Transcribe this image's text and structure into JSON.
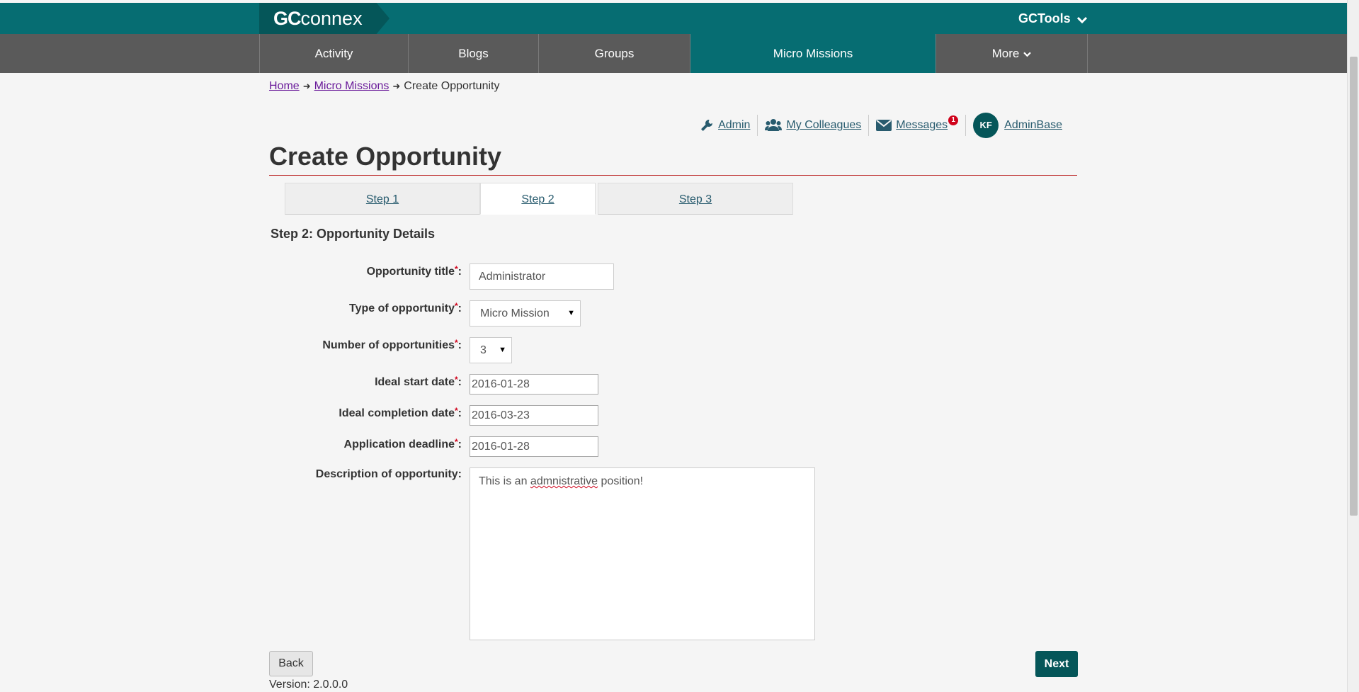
{
  "header": {
    "logo_bold": "GC",
    "logo_rest": "connex",
    "gctools_label": "GCTools"
  },
  "nav": {
    "items": [
      {
        "label": "Activity"
      },
      {
        "label": "Blogs"
      },
      {
        "label": "Groups"
      },
      {
        "label": "Micro Missions",
        "active": true
      },
      {
        "label": "More"
      }
    ]
  },
  "breadcrumb": {
    "home": "Home",
    "section": "Micro Missions",
    "current": "Create Opportunity"
  },
  "userbar": {
    "admin": "Admin",
    "colleagues": "My Colleagues",
    "messages": "Messages",
    "messages_count": "1",
    "avatar_initials": "KF",
    "username": "AdminBase"
  },
  "page": {
    "title": "Create Opportunity",
    "tabs": [
      {
        "label": "Step 1"
      },
      {
        "label": "Step 2",
        "active": true
      },
      {
        "label": "Step 3"
      }
    ],
    "step_heading": "Step 2: Opportunity Details"
  },
  "form": {
    "title_label": "Opportunity title",
    "title_value": "Administrator",
    "type_label": "Type of opportunity",
    "type_value": "Micro Mission",
    "number_label": "Number of opportunities",
    "number_value": "3",
    "start_label": "Ideal start date",
    "start_value": "2016-01-28",
    "completion_label": "Ideal completion date",
    "completion_value": "2016-03-23",
    "deadline_label": "Application deadline",
    "deadline_value": "2016-01-28",
    "description_label": "Description of opportunity:",
    "description_pre": "This is an ",
    "description_misspelled": "admnistrative",
    "description_post": " position!",
    "required_mark": "*",
    "label_suffix": ":"
  },
  "buttons": {
    "back": "Back",
    "next": "Next"
  },
  "footer": {
    "version": "Version: 2.0.0.0"
  },
  "colors": {
    "brand_teal": "#066d72",
    "nav_gray": "#5a5a5a",
    "required_red": "#d0021b"
  },
  "icons": [
    "chevron-down-icon",
    "wrench-icon",
    "users-icon",
    "envelope-icon",
    "arrow-right-icon"
  ]
}
